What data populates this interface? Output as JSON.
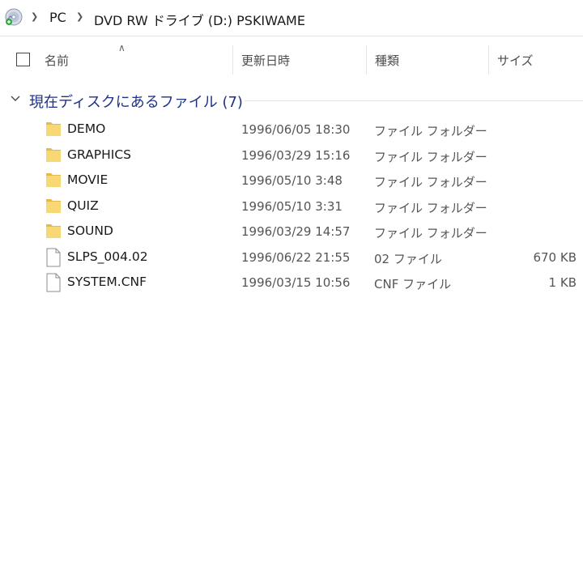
{
  "address": {
    "crumbs": [
      "PC",
      "DVD RW ドライブ (D:) PSKIWAME"
    ]
  },
  "columns": {
    "name": "名前",
    "date": "更新日時",
    "type": "種類",
    "size": "サイズ"
  },
  "group": {
    "title": "現在ディスクにあるファイル (7)"
  },
  "files": [
    {
      "name": "DEMO",
      "date": "1996/06/05 18:30",
      "type": "ファイル フォルダー",
      "size": "",
      "icon": "folder-icon"
    },
    {
      "name": "GRAPHICS",
      "date": "1996/03/29 15:16",
      "type": "ファイル フォルダー",
      "size": "",
      "icon": "folder-icon"
    },
    {
      "name": "MOVIE",
      "date": "1996/05/10 3:48",
      "type": "ファイル フォルダー",
      "size": "",
      "icon": "folder-icon"
    },
    {
      "name": "QUIZ",
      "date": "1996/05/10 3:31",
      "type": "ファイル フォルダー",
      "size": "",
      "icon": "folder-icon"
    },
    {
      "name": "SOUND",
      "date": "1996/03/29 14:57",
      "type": "ファイル フォルダー",
      "size": "",
      "icon": "folder-icon"
    },
    {
      "name": "SLPS_004.02",
      "date": "1996/06/22 21:55",
      "type": "02 ファイル",
      "size": "670 KB",
      "icon": "file-icon"
    },
    {
      "name": "SYSTEM.CNF",
      "date": "1996/03/15 10:56",
      "type": "CNF ファイル",
      "size": "1 KB",
      "icon": "file-icon"
    }
  ],
  "colors": {
    "group_title": "#1e3287",
    "folder": "#f8d775",
    "folder_dark": "#e7b94a"
  }
}
